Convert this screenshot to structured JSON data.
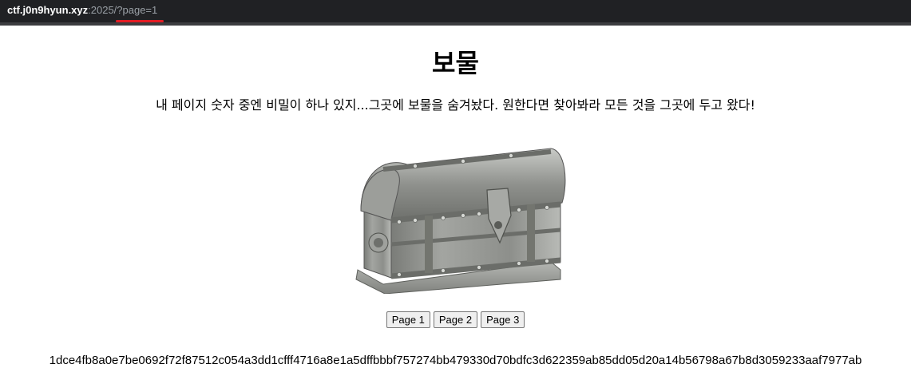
{
  "address_bar": {
    "host": "ctf.j0n9hyun.xyz",
    "rest": ":2025/?page=1",
    "highlight_color": "#e21b23"
  },
  "page": {
    "title": "보물",
    "description": "내 페이지 숫자 중엔 비밀이 하나 있지...그곳에 보물을 숨겨놨다. 원한다면 찾아봐라 모든 것을 그곳에 두고 왔다!",
    "image": "treasure-chest",
    "buttons": [
      {
        "label": "Page 1"
      },
      {
        "label": "Page 2"
      },
      {
        "label": "Page 3"
      }
    ],
    "hash": "1dce4fb8a0e7be0692f72f87512c054a3dd1cfff4716a8e1a5dffbbbf757274bb479330d70bdfc3d622359ab85dd05d20a14b56798a67b8d3059233aaf7977ab"
  }
}
